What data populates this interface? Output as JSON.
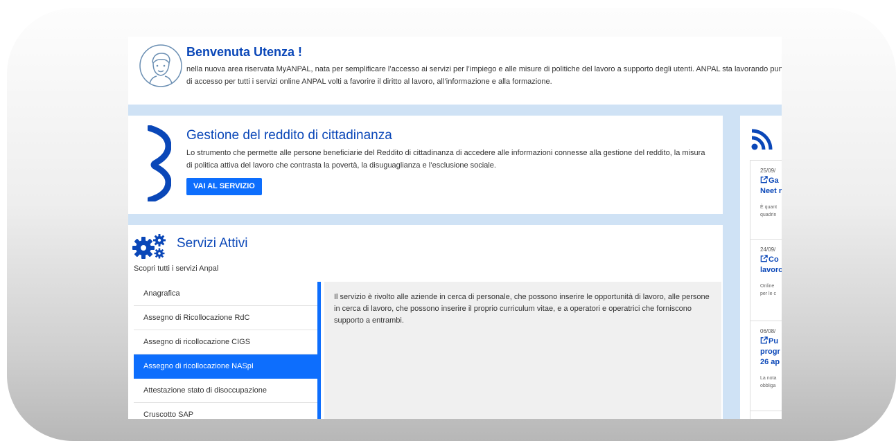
{
  "welcome": {
    "title": "Benvenuta Utenza !",
    "text": "nella nuova area riservata MyANPAL, nata per semplificare l’accesso ai servizi per l’impiego e alle misure di politiche del lavoro a supporto degli utenti. ANPAL sta lavorando punto di accesso per tutti i servizi online ANPAL volti a favorire il diritto al lavoro, all’informazione e alla formazione."
  },
  "rdc": {
    "title": "Gestione del reddito di cittadinanza",
    "text": "Lo strumento che permette alle persone beneficiarie del Reddito di cittadinanza di accedere alle informazioni connesse alla gestione del reddito, la misura di politica attiva del lavoro che contrasta la povertà, la disuguaglianza e l’esclusione sociale.",
    "button": "VAI AL SERVIZIO"
  },
  "services": {
    "title": "Servizi Attivi",
    "subtitle": "Scopri tutti i servizi Anpal",
    "items": [
      {
        "label": "Anagrafica"
      },
      {
        "label": "Assegno di Ricollocazione RdC"
      },
      {
        "label": "Assegno di ricollocazione CIGS"
      },
      {
        "label": "Assegno di ricollocazione NASpI"
      },
      {
        "label": "Attestazione stato di disoccupazione"
      },
      {
        "label": "Cruscotto SAP"
      }
    ],
    "active_index": 3,
    "description": "Il servizio è rivolto alle aziende in cerca di personale, che possono inserire le opportunità di lavoro, alle persone in cerca di lavoro, che possono inserire il proprio curriculum vitae, e a operatori e operatrici che forniscono supporto a entrambi."
  },
  "news": {
    "icon": "rss-icon",
    "items": [
      {
        "date": "25/09/",
        "title_lines": [
          "Ga",
          "Neet r"
        ],
        "desc_lines": [
          "È quant",
          "quadrin"
        ]
      },
      {
        "date": "24/09/",
        "title_lines": [
          "Co",
          "lavoro"
        ],
        "desc_lines": [
          "Online",
          "per le c"
        ]
      },
      {
        "date": "06/08/",
        "title_lines": [
          "Pu",
          "progr",
          "26 ap"
        ],
        "desc_lines": [
          "La nota",
          "obbliga"
        ]
      }
    ]
  },
  "colors": {
    "brand": "#0a47b8",
    "accent": "#0d6efd",
    "background": "#cfe2f5"
  }
}
